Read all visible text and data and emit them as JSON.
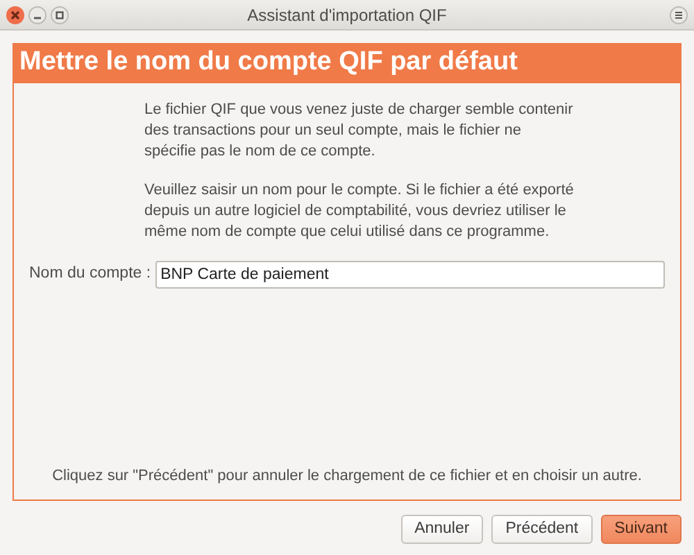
{
  "window": {
    "title": "Assistant d'importation QIF"
  },
  "page": {
    "heading": "Mettre le nom du compte QIF par défaut",
    "paragraphs": [
      "Le fichier QIF que vous venez juste de charger semble contenir des transactions pour un seul compte, mais le fichier ne spécifie pas le nom de ce compte.",
      "Veuillez saisir un nom pour le compte. Si le fichier a été exporté depuis un autre logiciel de comptabilité, vous devriez utiliser le même nom de compte que celui utilisé dans ce programme."
    ],
    "account_field": {
      "label": "Nom du compte :",
      "value": "BNP Carte de paiement"
    },
    "footer_note": "Cliquez sur \"Précédent\" pour annuler le chargement de ce fichier et en choisir un autre."
  },
  "buttons": [
    {
      "label": "Annuler",
      "kind": "normal"
    },
    {
      "label": "Précédent",
      "kind": "normal"
    },
    {
      "label": "Suivant",
      "kind": "suggested"
    }
  ]
}
